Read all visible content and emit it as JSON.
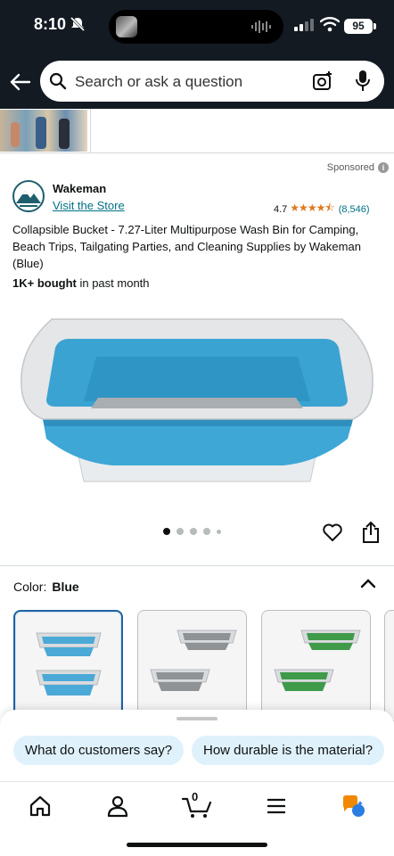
{
  "status_bar": {
    "time": "8:10",
    "battery": "95"
  },
  "search": {
    "placeholder": "Search or ask a question"
  },
  "sponsored": {
    "label": "Sponsored",
    "info_icon": "info-icon"
  },
  "brand": {
    "name": "Wakeman",
    "store_link": "Visit the Store",
    "rating": "4.7",
    "stars_value": 4.5,
    "review_count": "(8,546)"
  },
  "product": {
    "title": "Collapsible Bucket - 7.27-Liter Multipurpose Wash Bin for Camping, Beach Trips, Tailgating Parties, and Cleaning Supplies by Wakeman (Blue)",
    "bought_bold": "1K+ bought",
    "bought_rest": " in past month",
    "image_count": 5,
    "active_image": 1
  },
  "color": {
    "label": "Color:",
    "selected": "Blue",
    "options": [
      "Blue",
      "Gray",
      "Green"
    ]
  },
  "suggestions": [
    "What do customers say?",
    "How durable is the material?"
  ],
  "bottom_nav": {
    "cart_count": "0",
    "items": [
      "home-icon",
      "account-icon",
      "cart-icon",
      "menu-icon",
      "rufus-icon"
    ]
  },
  "colors": {
    "header_bg": "#131a22",
    "link": "#007185",
    "star": "#de7921",
    "chip_bg": "#dff1fb",
    "selected_border": "#2162a1",
    "bin_blue": "#3ea7d6",
    "bin_gray": "#8f9396",
    "bin_green": "#3f9a4a"
  }
}
